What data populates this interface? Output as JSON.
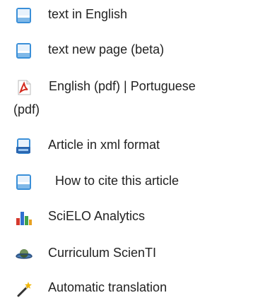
{
  "links": {
    "text_english": {
      "label": "text in English",
      "icon": "document-icon"
    },
    "text_new_page": {
      "label": "text new page (beta)",
      "icon": "document-icon"
    },
    "pdf": {
      "label_line1": "English (pdf) | Portuguese",
      "label_line2": "(pdf)",
      "icon": "pdf-icon"
    },
    "xml": {
      "label": "Article in xml format",
      "icon": "xml-icon"
    },
    "cite": {
      "label": "How to cite this article",
      "icon": "document-icon"
    },
    "analytics": {
      "label": "SciELO Analytics",
      "icon": "bar-chart-icon"
    },
    "curriculum": {
      "label": "Curriculum ScienTI",
      "icon": "planet-icon"
    },
    "translation": {
      "label": "Automatic translation",
      "icon": "magic-wand-icon"
    }
  },
  "colors": {
    "doc_blue": "#3a8fd8",
    "pdf_red": "#d42a1e",
    "text": "#222222"
  }
}
